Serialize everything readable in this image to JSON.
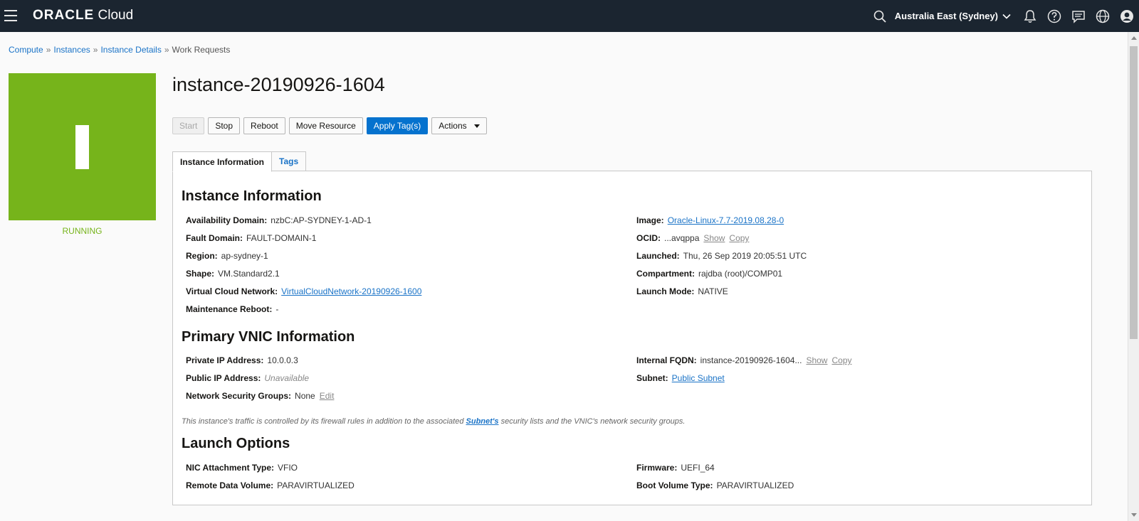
{
  "header": {
    "logo_brand": "ORACLE",
    "logo_product": "Cloud",
    "region": "Australia East (Sydney)"
  },
  "breadcrumb": [
    "Compute",
    "Instances",
    "Instance Details",
    "Work Requests"
  ],
  "instance": {
    "title": "instance-20190926-1604",
    "status": "RUNNING",
    "tile_letter": "I"
  },
  "buttons": {
    "start": "Start",
    "stop": "Stop",
    "reboot": "Reboot",
    "move": "Move Resource",
    "apply_tags": "Apply Tag(s)",
    "actions": "Actions"
  },
  "tabs": [
    "Instance Information",
    "Tags"
  ],
  "instance_info": {
    "heading": "Instance Information",
    "availability_domain": {
      "label": "Availability Domain:",
      "value": "nzbC:AP-SYDNEY-1-AD-1"
    },
    "fault_domain": {
      "label": "Fault Domain:",
      "value": "FAULT-DOMAIN-1"
    },
    "region": {
      "label": "Region:",
      "value": "ap-sydney-1"
    },
    "shape": {
      "label": "Shape:",
      "value": "VM.Standard2.1"
    },
    "vcn": {
      "label": "Virtual Cloud Network:",
      "value": "VirtualCloudNetwork-20190926-1600"
    },
    "maintenance": {
      "label": "Maintenance Reboot:",
      "value": "-"
    },
    "image": {
      "label": "Image:",
      "value": "Oracle-Linux-7.7-2019.08.28-0"
    },
    "ocid": {
      "label": "OCID:",
      "value": "...avqppa",
      "show": "Show",
      "copy": "Copy"
    },
    "launched": {
      "label": "Launched:",
      "value": "Thu, 26 Sep 2019 20:05:51 UTC"
    },
    "compartment": {
      "label": "Compartment:",
      "value": "rajdba (root)/COMP01"
    },
    "launch_mode": {
      "label": "Launch Mode:",
      "value": "NATIVE"
    }
  },
  "vnic": {
    "heading": "Primary VNIC Information",
    "private_ip": {
      "label": "Private IP Address:",
      "value": "10.0.0.3"
    },
    "public_ip": {
      "label": "Public IP Address:",
      "value": "Unavailable"
    },
    "nsg": {
      "label": "Network Security Groups:",
      "value": "None",
      "edit": "Edit"
    },
    "fqdn": {
      "label": "Internal FQDN:",
      "value": "instance-20190926-1604...",
      "show": "Show",
      "copy": "Copy"
    },
    "subnet": {
      "label": "Subnet:",
      "value": "Public Subnet"
    },
    "note_pre": "This instance's traffic is controlled by its firewall rules in addition to the associated ",
    "note_link": "Subnet's",
    "note_post": " security lists and the VNIC's network security groups."
  },
  "launch_options": {
    "heading": "Launch Options",
    "nic": {
      "label": "NIC Attachment Type:",
      "value": "VFIO"
    },
    "remote": {
      "label": "Remote Data Volume:",
      "value": "PARAVIRTUALIZED"
    },
    "firmware": {
      "label": "Firmware:",
      "value": "UEFI_64"
    },
    "boot": {
      "label": "Boot Volume Type:",
      "value": "PARAVIRTUALIZED"
    }
  },
  "colors": {
    "topbar": "#1b2530",
    "running": "#76b41b",
    "primary": "#0572ce",
    "link": "#1a73c7"
  },
  "icons": [
    "menu-icon",
    "search-icon",
    "chevron-down-icon",
    "bell-icon",
    "help-icon",
    "chat-icon",
    "globe-icon",
    "user-icon"
  ]
}
